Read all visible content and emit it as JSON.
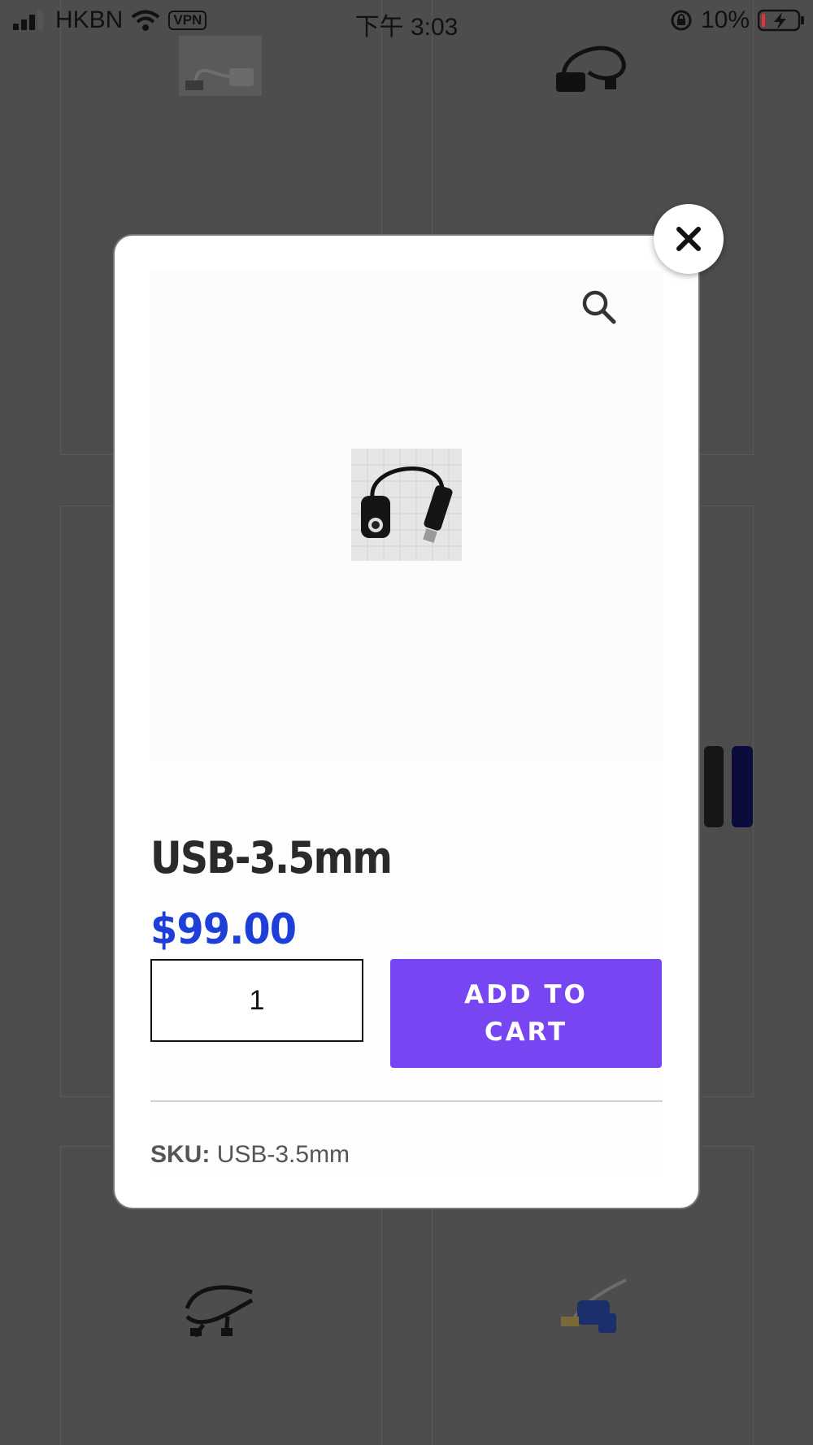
{
  "status_bar": {
    "carrier": "HKBN",
    "vpn": "VPN",
    "time": "下午 3:03",
    "battery": "10%"
  },
  "modal": {
    "title": "USB-3.5mm",
    "price": "$99.00",
    "quantity": "1",
    "add_to_cart_label": "ADD TO CART",
    "sku_label": "SKU:",
    "sku_value": "USB-3.5mm"
  },
  "colors": {
    "accent_button": "#7745f2",
    "price": "#1d3fd8",
    "overlay": "#4d4d4d"
  },
  "icons": {
    "close": "close-icon",
    "zoom": "search-icon"
  }
}
